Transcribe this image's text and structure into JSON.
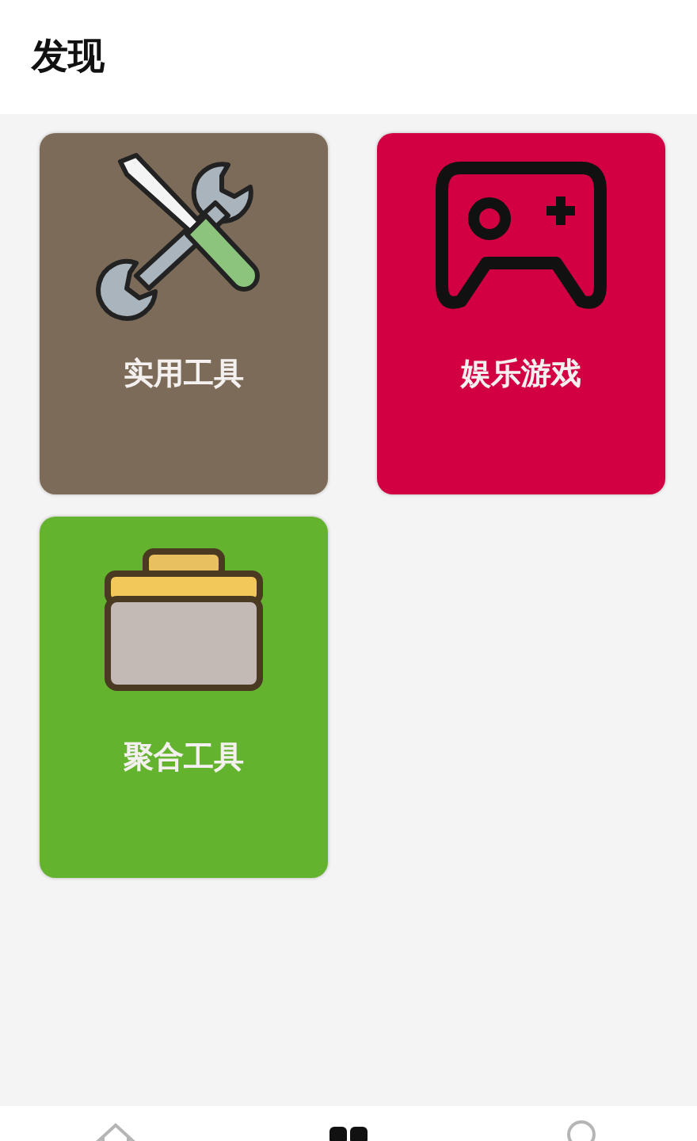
{
  "header": {
    "title": "发现"
  },
  "cards": [
    {
      "label": "实用工具",
      "kind": "tools",
      "color": "#7b6b58"
    },
    {
      "label": "娱乐游戏",
      "kind": "gamepad",
      "color": "#d20043"
    },
    {
      "label": "聚合工具",
      "kind": "toolbox",
      "color": "#63b32e"
    }
  ],
  "bottom_nav": [
    {
      "kind": "home",
      "selected": false
    },
    {
      "kind": "grid",
      "selected": true
    },
    {
      "kind": "person",
      "selected": false
    }
  ]
}
